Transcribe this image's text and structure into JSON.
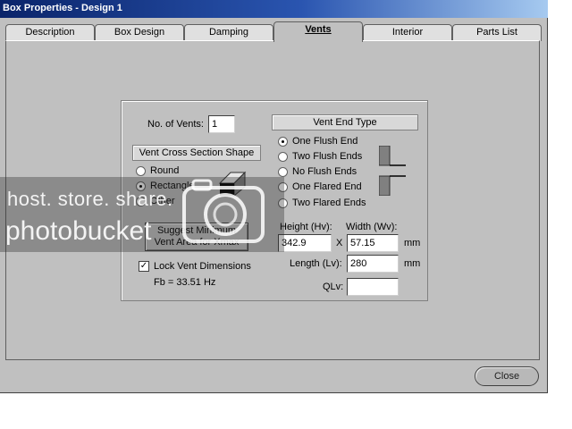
{
  "window": {
    "title": "Box Properties - Design 1"
  },
  "tabs": [
    {
      "label": "Description"
    },
    {
      "label": "Box Design"
    },
    {
      "label": "Damping"
    },
    {
      "label": "Vents",
      "active": true
    },
    {
      "label": "Interior"
    },
    {
      "label": "Parts List"
    }
  ],
  "vents": {
    "count_label": "No. of Vents:",
    "count_value": "1",
    "shape_header": "Vent Cross Section Shape",
    "shapes": [
      {
        "label": "Round",
        "selected": false
      },
      {
        "label": "Rectangle",
        "selected": true
      },
      {
        "label": "Other",
        "selected": false
      }
    ],
    "suggest_button_line1": "Suggest Minimum",
    "suggest_button_line2": "Vent Area for Xmax",
    "lock_label": "Lock Vent Dimensions",
    "lock_checked": true,
    "fb_text": "Fb = 33.51 Hz",
    "end_type_header": "Vent End Type",
    "end_types": [
      {
        "label": "One Flush End",
        "selected": true
      },
      {
        "label": "Two Flush Ends",
        "selected": false
      },
      {
        "label": "No Flush Ends",
        "selected": false
      },
      {
        "label": "One Flared End",
        "selected": false
      },
      {
        "label": "Two Flared Ends",
        "selected": false
      }
    ],
    "height_label": "Height (Hv):",
    "height_value": "342.9",
    "x_label": "X",
    "width_label": "Width (Wv):",
    "width_value": "57.15",
    "width_unit": "mm",
    "length_label": "Length (Lv):",
    "length_value": "280",
    "length_unit": "mm",
    "qlv_label": "QLv:",
    "qlv_value": ""
  },
  "footer": {
    "close_label": "Close"
  },
  "watermark": {
    "line1": "host. store. share.",
    "line2": "photobucket"
  },
  "colors": {
    "titlebar_start": "#0a246a",
    "titlebar_end": "#a6caf0",
    "panel": "#c0c0c0"
  }
}
